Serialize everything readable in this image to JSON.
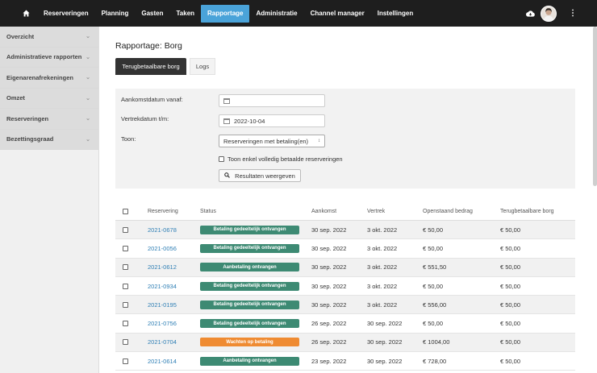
{
  "nav": {
    "home_icon": "home-icon",
    "items": [
      "Reserveringen",
      "Planning",
      "Gasten",
      "Taken",
      "Rapportage",
      "Administratie",
      "Channel manager",
      "Instellingen"
    ],
    "active": "Rapportage"
  },
  "sidebar": {
    "items": [
      {
        "label": "Overzicht"
      },
      {
        "label": "Administratieve rapporten"
      },
      {
        "label": "Eigenarenafrekeningen"
      },
      {
        "label": "Omzet"
      },
      {
        "label": "Reserveringen"
      },
      {
        "label": "Bezettingsgraad"
      }
    ]
  },
  "page": {
    "title": "Rapportage: Borg",
    "tabs": [
      {
        "label": "Terugbetaalbare borg",
        "active": true
      },
      {
        "label": "Logs",
        "active": false
      }
    ]
  },
  "filters": {
    "arrival_label": "Aankomstdatum vanaf:",
    "arrival_value": "",
    "departure_label": "Vertrekdatum t/m:",
    "departure_value": "2022-10-04",
    "show_label": "Toon:",
    "show_value": "Reserveringen met betaling(en)",
    "paid_only_label": "Toon enkel volledig betaalde reserveringen",
    "submit_label": "Resultaten weergeven"
  },
  "table": {
    "headers": [
      "Reservering",
      "Status",
      "Aankomst",
      "Vertrek",
      "Openstaand bedrag",
      "Terugbetaalbare borg"
    ],
    "rows": [
      {
        "id": "2021-0678",
        "status": "Betaling gedeeltelijk ontvangen",
        "status_color": "green",
        "arrival": "30 sep. 2022",
        "departure": "3 okt. 2022",
        "outstanding": "€ 50,00",
        "deposit": "€ 50,00"
      },
      {
        "id": "2021-0056",
        "status": "Betaling gedeeltelijk ontvangen",
        "status_color": "green",
        "arrival": "30 sep. 2022",
        "departure": "3 okt. 2022",
        "outstanding": "€ 50,00",
        "deposit": "€ 50,00"
      },
      {
        "id": "2021-0612",
        "status": "Aanbetaling ontvangen",
        "status_color": "green",
        "arrival": "30 sep. 2022",
        "departure": "3 okt. 2022",
        "outstanding": "€ 551,50",
        "deposit": "€ 50,00"
      },
      {
        "id": "2021-0934",
        "status": "Betaling gedeeltelijk ontvangen",
        "status_color": "green",
        "arrival": "30 sep. 2022",
        "departure": "3 okt. 2022",
        "outstanding": "€ 50,00",
        "deposit": "€ 50,00"
      },
      {
        "id": "2021-0195",
        "status": "Betaling gedeeltelijk ontvangen",
        "status_color": "green",
        "arrival": "30 sep. 2022",
        "departure": "3 okt. 2022",
        "outstanding": "€ 556,00",
        "deposit": "€ 50,00"
      },
      {
        "id": "2021-0756",
        "status": "Betaling gedeeltelijk ontvangen",
        "status_color": "green",
        "arrival": "26 sep. 2022",
        "departure": "30 sep. 2022",
        "outstanding": "€ 50,00",
        "deposit": "€ 50,00"
      },
      {
        "id": "2021-0704",
        "status": "Wachten op betaling",
        "status_color": "orange",
        "arrival": "26 sep. 2022",
        "departure": "30 sep. 2022",
        "outstanding": "€ 1004,00",
        "deposit": "€ 50,00"
      },
      {
        "id": "2021-0614",
        "status": "Aanbetaling ontvangen",
        "status_color": "green",
        "arrival": "23 sep. 2022",
        "departure": "30 sep. 2022",
        "outstanding": "€ 728,00",
        "deposit": "€ 50,00"
      }
    ]
  },
  "colors": {
    "nav_bg": "#1e1e1e",
    "nav_active": "#4aa3d9",
    "link": "#2f7fb5",
    "badge_green": "#3d8a73",
    "badge_orange": "#ef8b32"
  }
}
